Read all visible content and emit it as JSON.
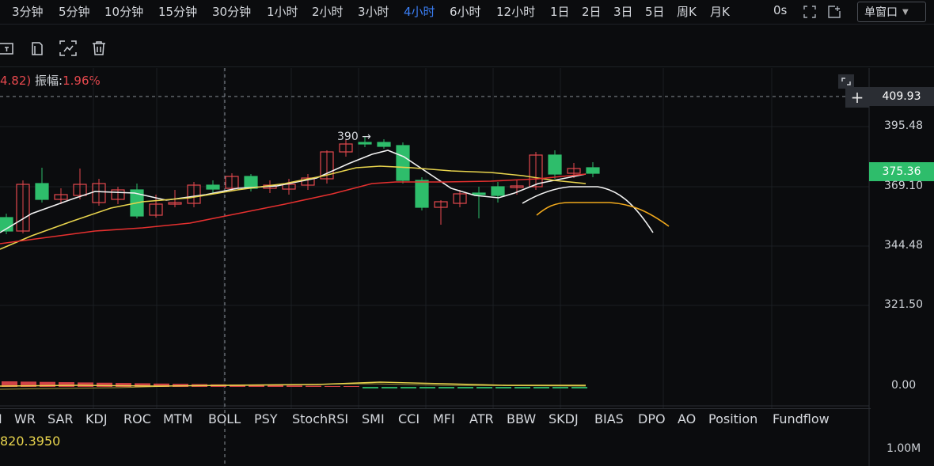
{
  "timeframes": [
    "3分钟",
    "5分钟",
    "10分钟",
    "15分钟",
    "30分钟",
    "1小时",
    "2小时",
    "3小时",
    "4小时",
    "6小时",
    "12小时",
    "1日",
    "2日",
    "3日",
    "5日",
    "周K",
    "月K"
  ],
  "active_timeframe": "4小时",
  "countdown": "0s",
  "window_mode": "单窗口",
  "info_prefix": "4.82)",
  "amplitude_label": "振幅:",
  "amplitude_value": "1.96%",
  "y_axis_ticks": [
    "409.93",
    "395.48",
    "369.10",
    "344.48",
    "321.50"
  ],
  "crosshair_price": "409.93",
  "last_price": "375.36",
  "osc_zero": "0.00",
  "volume_axis": "1.00M",
  "high_marker": "390",
  "indicator_tabs": [
    "I",
    "WR",
    "SAR",
    "KDJ",
    "ROC",
    "MTM",
    "BOLL",
    "PSY",
    "StochRSI",
    "SMI",
    "CCI",
    "MFI",
    "ATR",
    "BBW",
    "SKDJ",
    "BIAS",
    "DPO",
    "AO",
    "Position",
    "Fundflow"
  ],
  "volume_value": "820.3950",
  "colors": {
    "up": "#2ebd6b",
    "down": "#e5484d",
    "accent": "#3b7ff6",
    "ma_white": "#f2f2f2",
    "ma_yellow": "#e8d44d",
    "ma_red": "#e5302f",
    "ma_orange": "#f0a81c",
    "last_price_bg": "#2ebd6b"
  }
}
